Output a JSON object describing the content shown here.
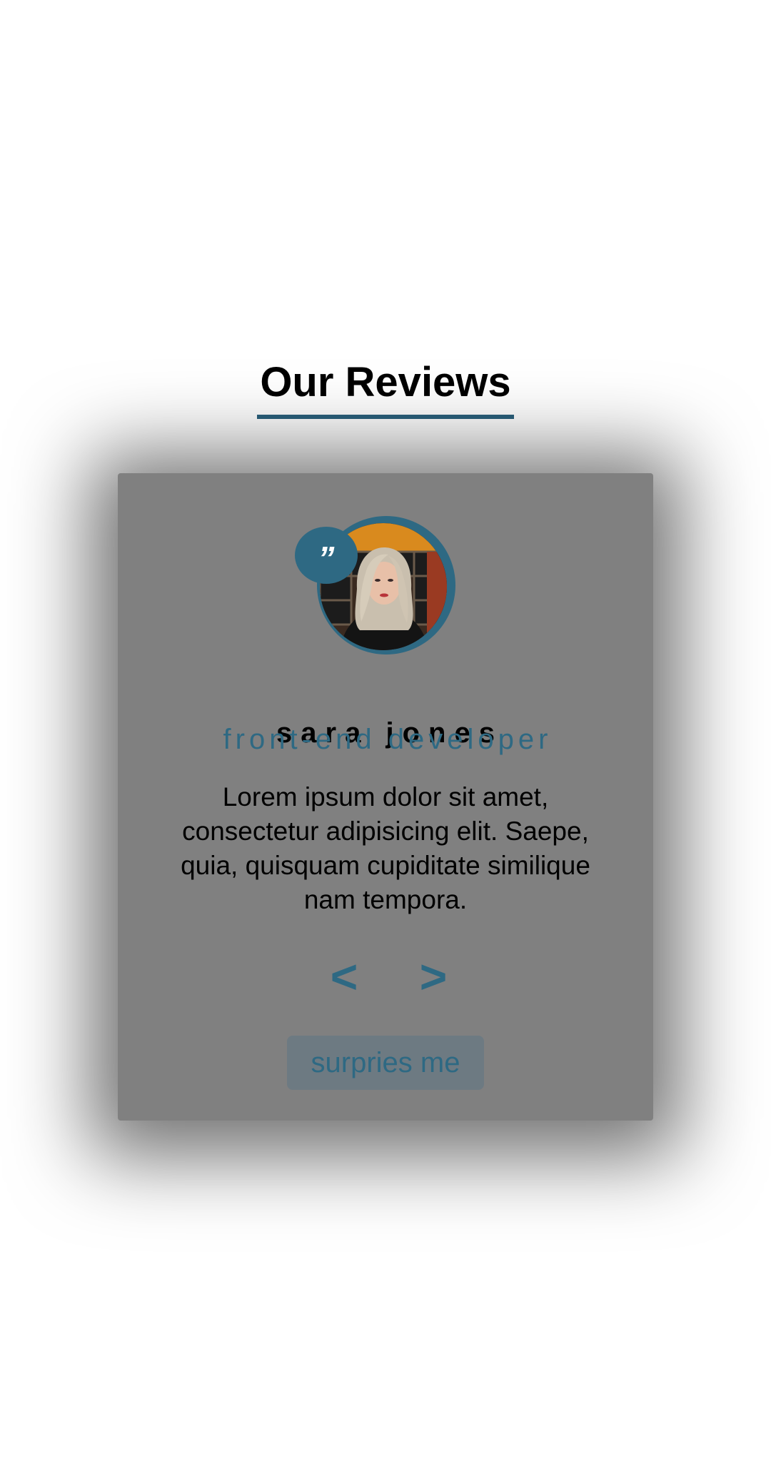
{
  "header": {
    "title": "Our Reviews"
  },
  "review": {
    "quote_icon": "quote-icon",
    "quote_glyph": "”",
    "author": "sara jones",
    "job": "front-end developer",
    "text": "Lorem ipsum dolor sit amet, consectetur adipisicing elit. Saepe, quia, quisquam cupiditate similique nam tempora."
  },
  "controls": {
    "prev_label": "<",
    "next_label": ">",
    "random_label": "surpries me"
  },
  "colors": {
    "accent": "#2e6983",
    "card_background": "#808080",
    "underline": "#2b617d"
  }
}
